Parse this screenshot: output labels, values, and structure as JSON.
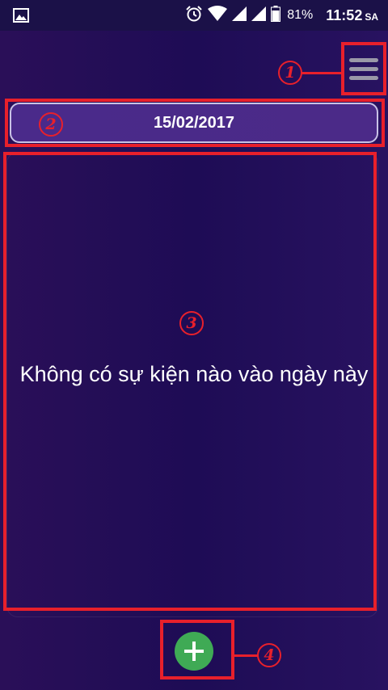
{
  "status_bar": {
    "battery_percent": "81%",
    "time": "11:52",
    "time_suffix": "SA",
    "icons": [
      "image-icon",
      "alarm-icon",
      "wifi-icon",
      "signal-icon",
      "signal-icon",
      "battery-icon"
    ]
  },
  "menu": {
    "icon": "hamburger-menu-icon"
  },
  "date_selector": {
    "value": "15/02/2017"
  },
  "events": {
    "empty_message": "Không có sự kiện nào vào ngày này"
  },
  "fab": {
    "icon": "plus-icon"
  },
  "annotations": {
    "labels": [
      "1",
      "2",
      "3",
      "4"
    ],
    "color": "#e8202b"
  },
  "colors": {
    "fab": "#3faa55",
    "date_pill": "#4a2a8a",
    "background": "#1e0c55"
  }
}
